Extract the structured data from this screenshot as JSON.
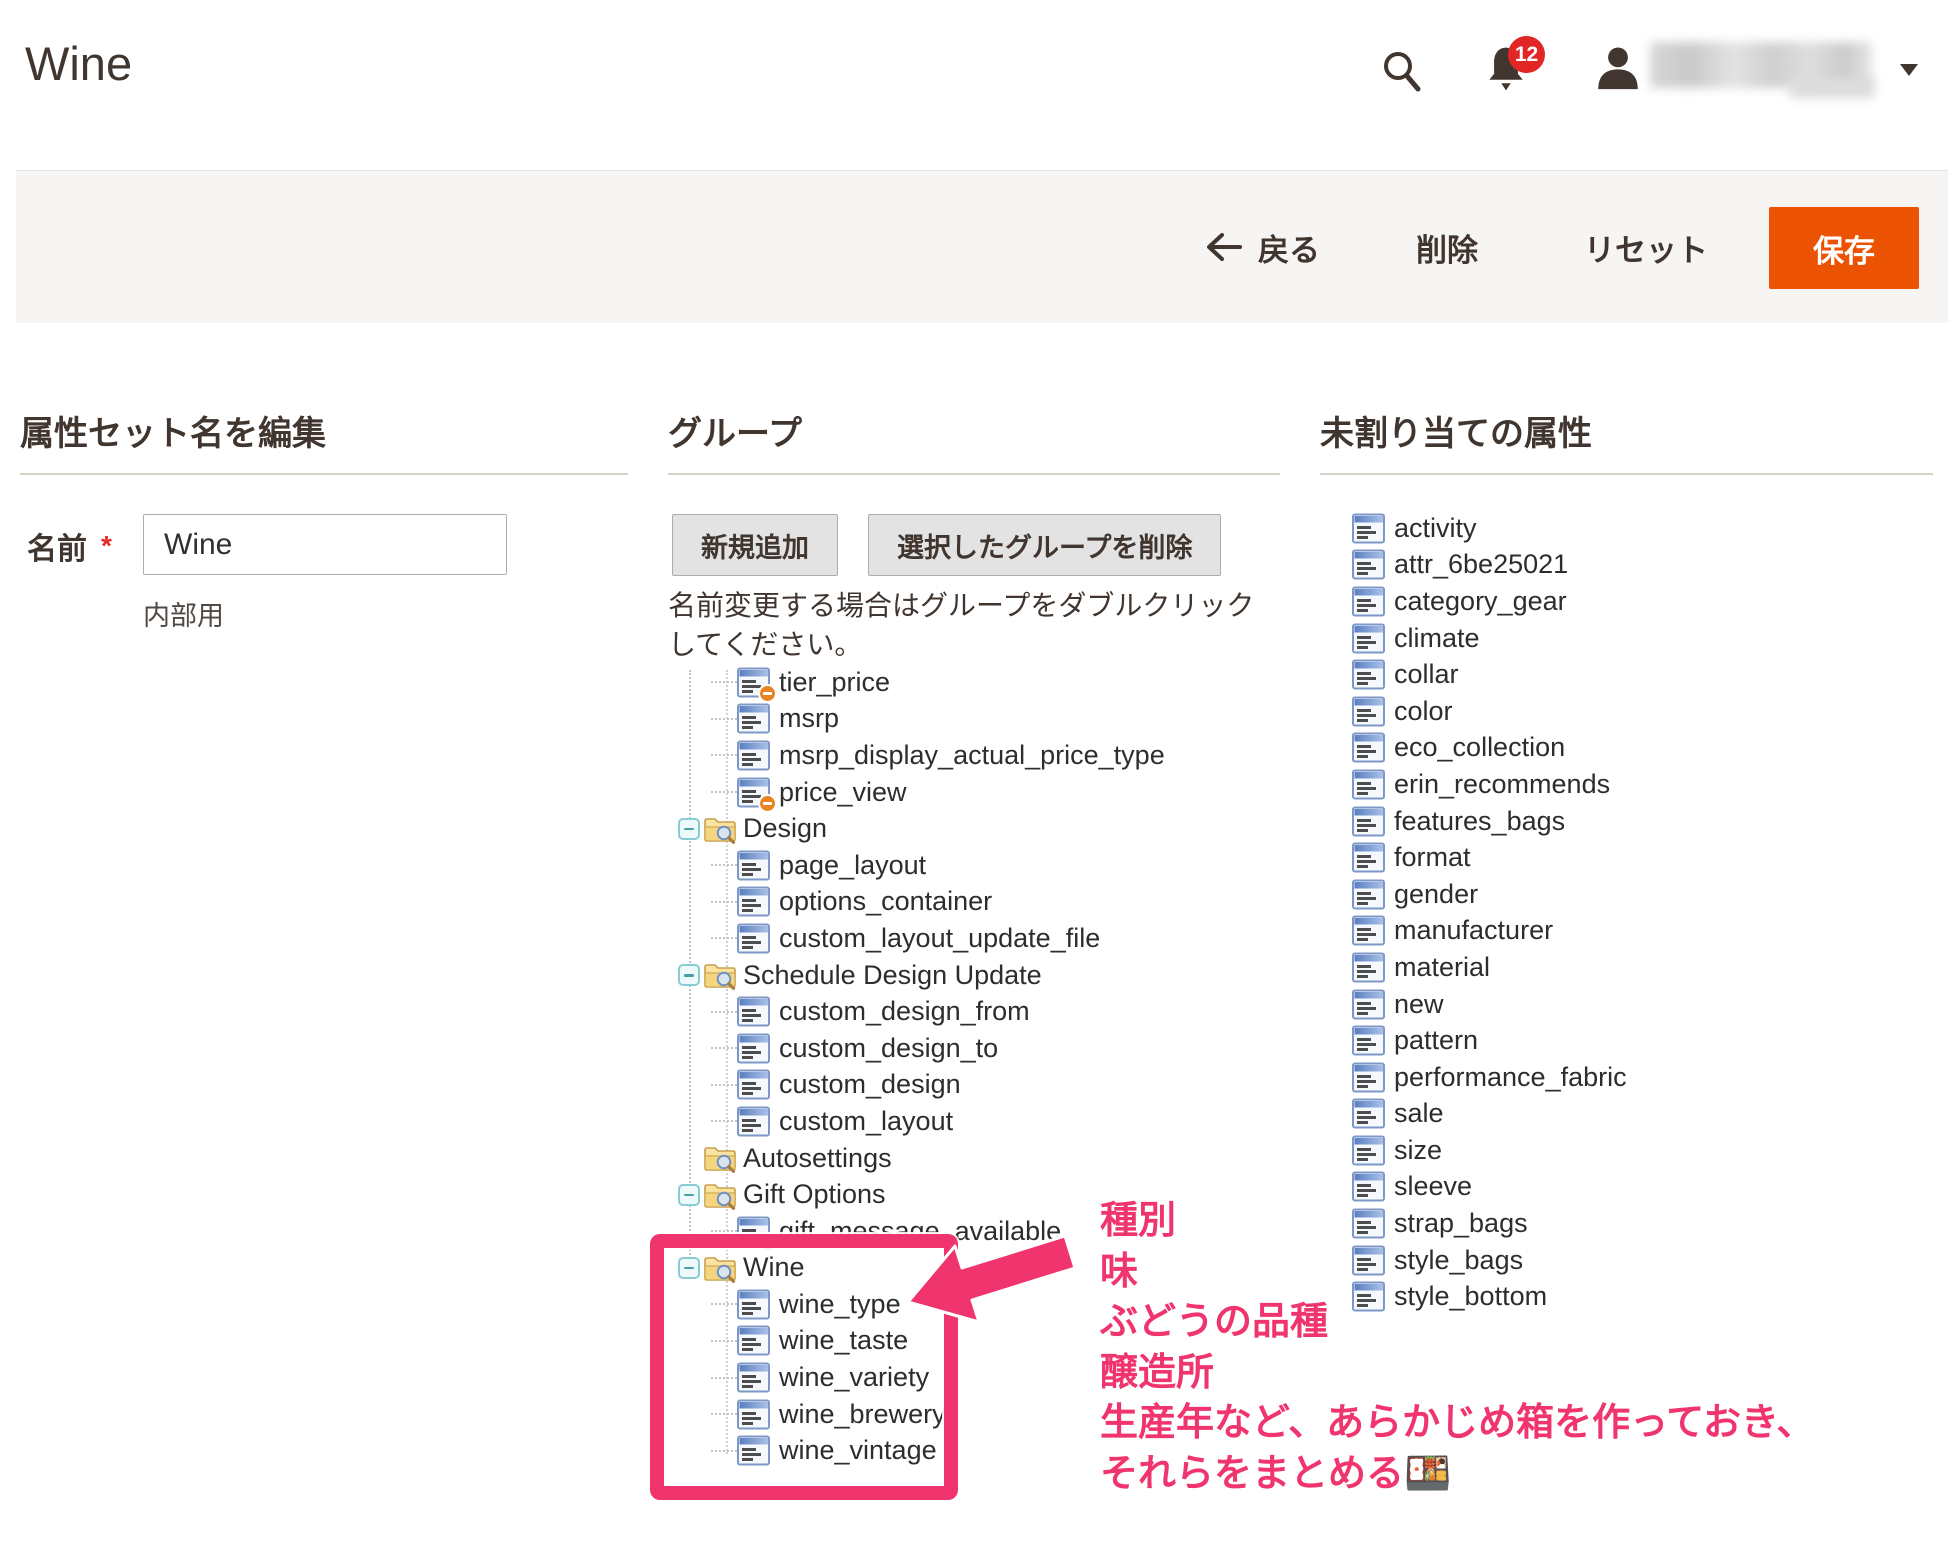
{
  "page": {
    "title": "Wine"
  },
  "header": {
    "notification_count": "12",
    "icons": [
      "search-icon",
      "notification-bell-icon",
      "user-avatar-icon",
      "dropdown-caret-icon"
    ],
    "user_name_visible": false
  },
  "toolbar": {
    "back": "戻る",
    "delete": "削除",
    "reset": "リセット",
    "save": "保存"
  },
  "left_panel": {
    "heading": "属性セット名を編集",
    "name_label": "名前",
    "required_mark": "*",
    "name_value": "Wine",
    "name_hint": "内部用"
  },
  "groups_panel": {
    "heading": "グループ",
    "add_button": "新規追加",
    "delete_button": "選択したグループを削除",
    "instruction": "名前変更する場合はグループをダブルクリックしてください。",
    "tree": [
      {
        "label": "tier_price",
        "kind": "leaf",
        "badge": true
      },
      {
        "label": "msrp",
        "kind": "leaf",
        "badge": false
      },
      {
        "label": "msrp_display_actual_price_type",
        "kind": "leaf",
        "badge": false
      },
      {
        "label": "price_view",
        "kind": "leaf",
        "badge": true
      },
      {
        "label": "Design",
        "kind": "folder",
        "toggle": true
      },
      {
        "label": "page_layout",
        "kind": "leaf",
        "badge": false
      },
      {
        "label": "options_container",
        "kind": "leaf",
        "badge": false
      },
      {
        "label": "custom_layout_update_file",
        "kind": "leaf",
        "badge": false
      },
      {
        "label": "Schedule Design Update",
        "kind": "folder",
        "toggle": true
      },
      {
        "label": "custom_design_from",
        "kind": "leaf",
        "badge": false
      },
      {
        "label": "custom_design_to",
        "kind": "leaf",
        "badge": false
      },
      {
        "label": "custom_design",
        "kind": "leaf",
        "badge": false
      },
      {
        "label": "custom_layout",
        "kind": "leaf",
        "badge": false
      },
      {
        "label": "Autosettings",
        "kind": "folder",
        "toggle": false
      },
      {
        "label": "Gift Options",
        "kind": "folder",
        "toggle": true
      },
      {
        "label": "gift_message_available",
        "kind": "leaf",
        "badge": true
      },
      {
        "label": "Wine",
        "kind": "folder",
        "toggle": true
      },
      {
        "label": "wine_type",
        "kind": "leaf",
        "badge": false
      },
      {
        "label": "wine_taste",
        "kind": "leaf",
        "badge": false
      },
      {
        "label": "wine_variety",
        "kind": "leaf",
        "badge": false
      },
      {
        "label": "wine_brewery",
        "kind": "leaf",
        "badge": false
      },
      {
        "label": "wine_vintage",
        "kind": "leaf",
        "badge": false
      }
    ]
  },
  "unassigned_panel": {
    "heading": "未割り当ての属性",
    "items": [
      "activity",
      "attr_6be25021",
      "category_gear",
      "climate",
      "collar",
      "color",
      "eco_collection",
      "erin_recommends",
      "features_bags",
      "format",
      "gender",
      "manufacturer",
      "material",
      "new",
      "pattern",
      "performance_fabric",
      "sale",
      "size",
      "sleeve",
      "strap_bags",
      "style_bags",
      "style_bottom"
    ]
  },
  "annotation": {
    "lines": [
      "種別",
      "味",
      "ぶどうの品種",
      "醸造所",
      "生産年など、あらかじめ箱を作っておき、",
      "それらをまとめる🍱"
    ]
  },
  "colors": {
    "accent_orange": "#eb5202",
    "badge_red": "#e22626",
    "annotation_pink": "#f0356e",
    "heading_text": "#41362f"
  }
}
